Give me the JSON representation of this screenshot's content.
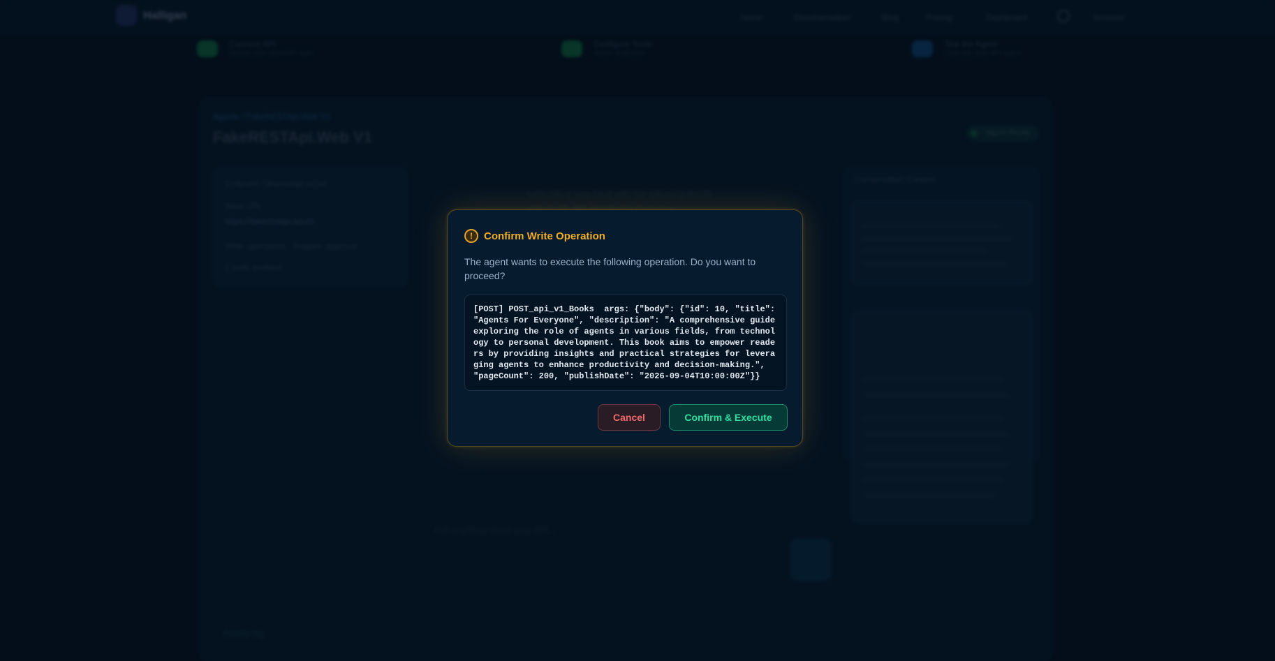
{
  "background": {
    "logo_text": "Halligan",
    "nav": [
      "Home",
      "Documentation",
      "Blog",
      "Pricing",
      "Dashboard"
    ],
    "user": "Account",
    "steps": [
      {
        "title": "Connect API",
        "sub": "Upload your OpenAPI spec",
        "color": "#0f5b3c"
      },
      {
        "title": "Configure Tools",
        "sub": "Select endpoints",
        "color": "#0f5b3c"
      },
      {
        "title": "Test the Agent",
        "sub": "Chat with your API agent",
        "color": "#0e3e6a"
      }
    ],
    "breadcrumb": "Agents / FakeRESTApi.Web V1",
    "title": "FakeRESTApi.Web V1",
    "status": "Agent Ready",
    "left_panel": [
      "Endpoint: fakerestapi.azure",
      "Base URL",
      "https://fakerestapi.azure",
      "Write operations · Require approval",
      "2 tools enabled"
    ],
    "center_lines": [
      "Let's add a new book with the following details",
      "with ID 10, title Agents For Everyone"
    ],
    "input_placeholder": "Ask anything about your API...",
    "right_panel_title": "Conversation Context",
    "bottom_title": "Activity log"
  },
  "modal": {
    "title": "Confirm Write Operation",
    "warning_icon": "!",
    "description": "The agent wants to execute the following operation. Do you want to proceed?",
    "code": "[POST] POST_api_v1_Books  args: {\"body\": {\"id\": 10, \"title\": \"Agents For Everyone\", \"description\": \"A comprehensive guide exploring the role of agents in various fields, from technology to personal development. This book aims to empower readers by providing insights and practical strategies for leveraging agents to enhance productivity and decision-making.\", \"pageCount\": 200, \"publishDate\": \"2026-09-04T10:00:00Z\"}}",
    "cancel_label": "Cancel",
    "confirm_label": "Confirm & Execute"
  },
  "colors": {
    "accent_warning": "#f1ad24",
    "cancel": "#f06b6b",
    "confirm": "#2fe0a0",
    "background": "#061526"
  }
}
